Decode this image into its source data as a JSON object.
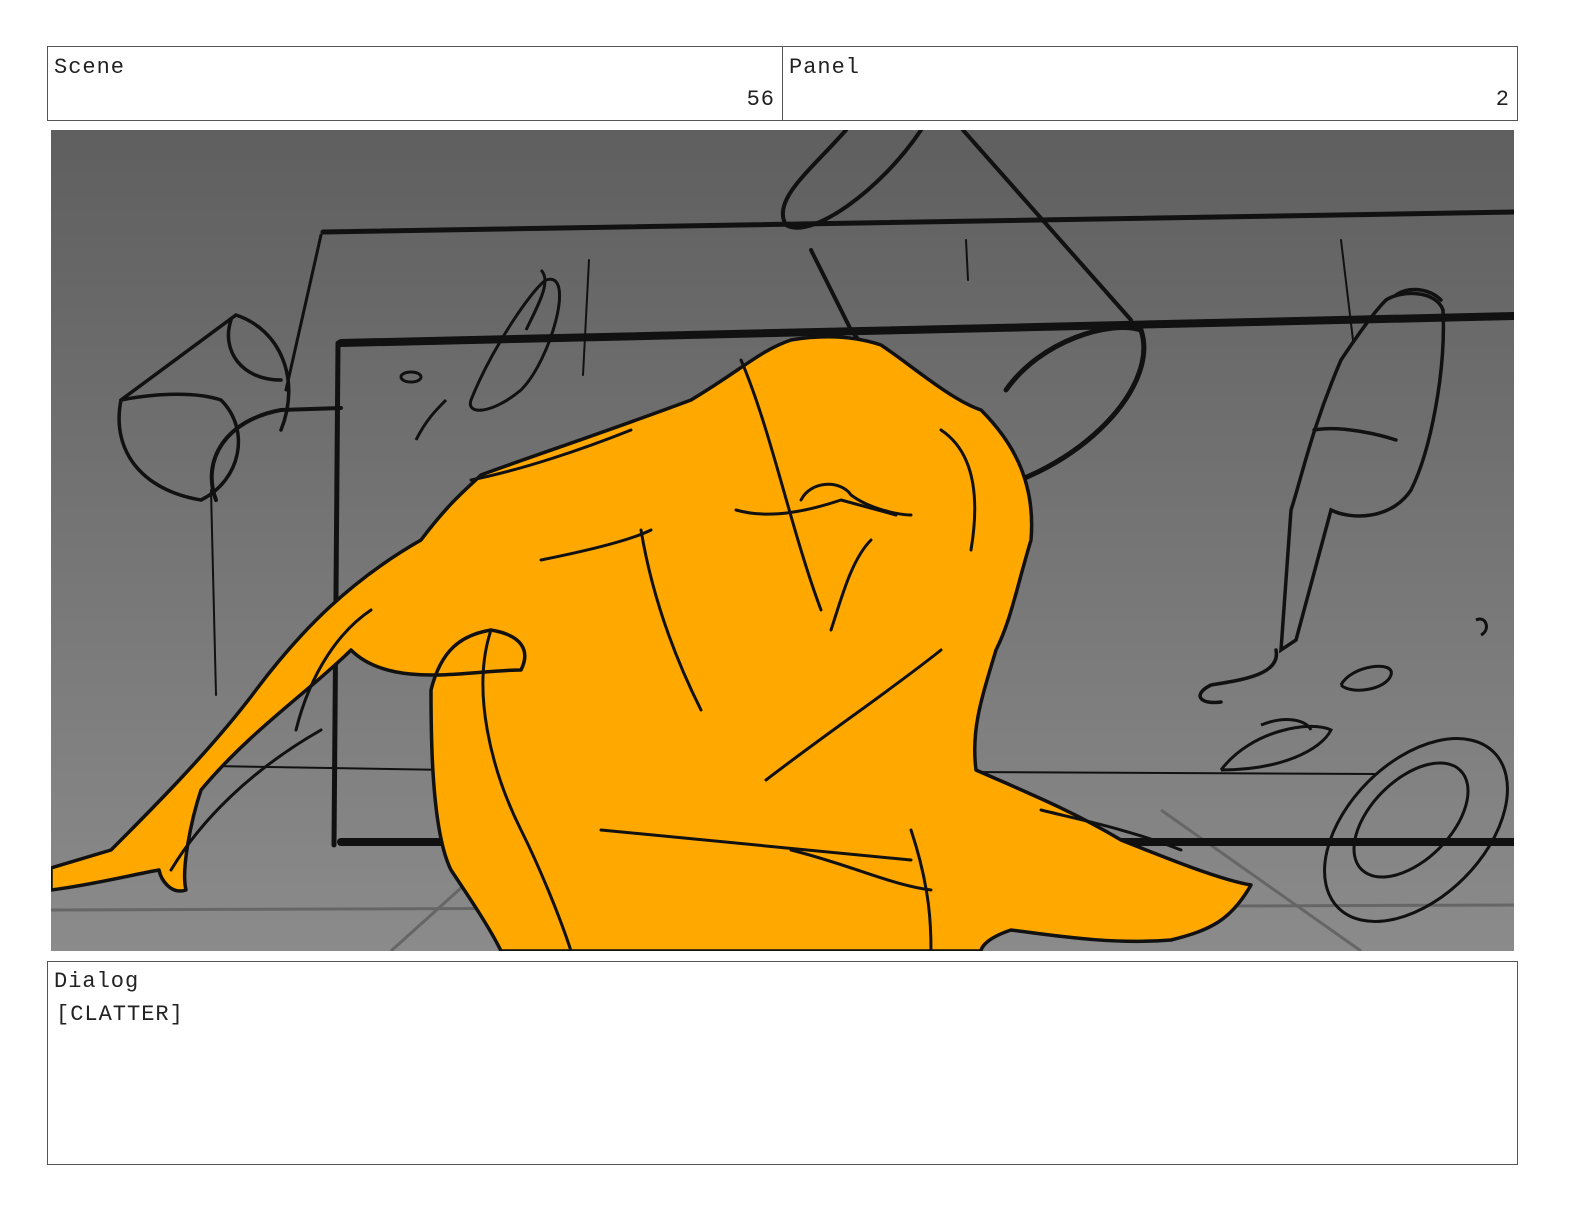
{
  "header": {
    "scene_label": "Scene",
    "scene_value": "56",
    "panel_label": "Panel",
    "panel_value": "2"
  },
  "panel_image": {
    "description_icon": "storyboard-sketch-icon",
    "colors": {
      "background_top": "#606060",
      "background_bottom": "#8a8a8a",
      "figure_fill": "#ffa800",
      "line": "#111111"
    }
  },
  "dialog": {
    "label": "Dialog",
    "text": "[CLATTER]"
  }
}
